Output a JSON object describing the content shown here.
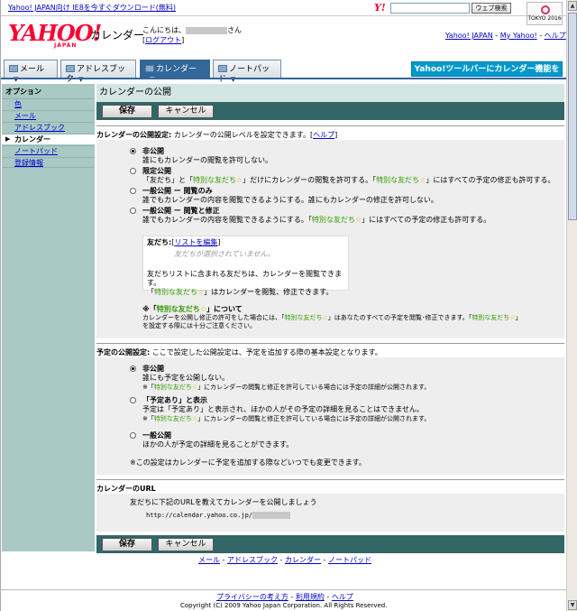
{
  "topbar": {
    "ie_link": "Yahoo! JAPAN向け IE8を今すぐダウンロード(無料)",
    "y_mark": "Y!",
    "search_placeholder": "",
    "search_button": "ウェブ検索",
    "badge_text": "TOKYO 2016"
  },
  "header": {
    "logo": "YAHOO!",
    "logo_sub": "JAPAN",
    "product": "カレンダー",
    "greeting_prefix": "こんにちは、",
    "greeting_suffix": "さん",
    "logout": "ログアウト",
    "links": [
      "Yahoo! JAPAN",
      "My Yahoo!",
      "ヘルプ"
    ]
  },
  "tabs": [
    {
      "label": "メール"
    },
    {
      "label": "アドレスブック"
    },
    {
      "label": "カレンダー",
      "active": true
    },
    {
      "label": "ノートパッド"
    }
  ],
  "toolbar_promo": "Yahoo!ツールバーにカレンダー機能を追加",
  "sidebar": {
    "title": "オプション",
    "items": [
      {
        "label": "色"
      },
      {
        "label": "メール"
      },
      {
        "label": "アドレスブック"
      },
      {
        "label": "カレンダー",
        "active": true
      },
      {
        "label": "ノートパッド"
      },
      {
        "label": "登録情報"
      }
    ]
  },
  "main": {
    "title": "カレンダーの公開",
    "save_label": "保存",
    "cancel_label": "キャンセル",
    "publish_setting": {
      "label": "カレンダーの公開設定:",
      "desc": "カレンダーの公開レベルを設定できます。",
      "help": "ヘルプ",
      "options": [
        {
          "label": "非公開",
          "desc": "誰にもカレンダーの閲覧を許可しない。",
          "selected": true
        },
        {
          "label": "限定公開",
          "desc_a": "「友だち」と「",
          "special": "特別な友だち",
          "desc_b": "」だけにカレンダーの閲覧を許可する。「",
          "desc_c": "」にはすべての予定の修正も許可する。"
        },
        {
          "label": "一般公開 ー 閲覧のみ",
          "desc": "誰でもカレンダーの内容を閲覧できるようにする。誰にもカレンダーの修正を許可しない。"
        },
        {
          "label": "一般公開 ー 閲覧と修正",
          "desc_a": "誰でもカレンダーの内容を閲覧できるようにする。「",
          "desc_b": "」にはすべての予定の修正も許可する。"
        }
      ],
      "friends": {
        "label": "友だち:",
        "edit_link": "リストを編集",
        "empty": "友だちが選択されていません。",
        "note1": "友だちリストに含まれる友だちは、カレンダーを閲覧できます。",
        "note2_b": "」はカレンダーを閲覧、修正できます。"
      },
      "special_note": {
        "title_suffix": "」について",
        "line1_a": "カレンダーを公開し修正の許可をした場合には、「",
        "line1_b": "」はあなたのすべての予定を閲覧･修正できます。「",
        "line2": "を設定する際には十分ご注意ください。"
      }
    },
    "schedule_setting": {
      "label": "予定の公開設定:",
      "desc": "ここで設定した公開設定は、予定を追加する際の基本設定となります。",
      "options": [
        {
          "label": "非公開",
          "desc": "誰にも予定を公開しない。",
          "note_b": "」にカレンダーの閲覧と修正を許可している場合には予定の詳細が公開されます。",
          "selected": true
        },
        {
          "label": "「予定あり」と表示",
          "desc": "予定は「予定あり」と表示され、ほかの人がその予定の詳細を見ることはできません。",
          "note_b": "」にカレンダーの閲覧と修正を許可している場合には予定の詳細が公開されます。"
        },
        {
          "label": "一般公開",
          "desc": "ほかの人が予定の詳細を見ることができます。"
        }
      ],
      "footnote": "※この設定はカレンダーに予定を追加する際などいつでも変更できます。"
    },
    "url_section": {
      "label": "カレンダーのURL",
      "desc": "友だちに下記のURLを教えてカレンダーを公開しましょう",
      "url": "http://calendar.yahoo.co.jp/"
    }
  },
  "footer": {
    "nav": [
      "メール",
      "アドレスブック",
      "カレンダー",
      "ノートパッド"
    ],
    "links": [
      "プライバシーの考え方",
      "利用規約",
      "ヘルプ"
    ],
    "copyright": "Copyright (C) 2009 Yahoo Japan Corporation. All Rights Reserved."
  }
}
